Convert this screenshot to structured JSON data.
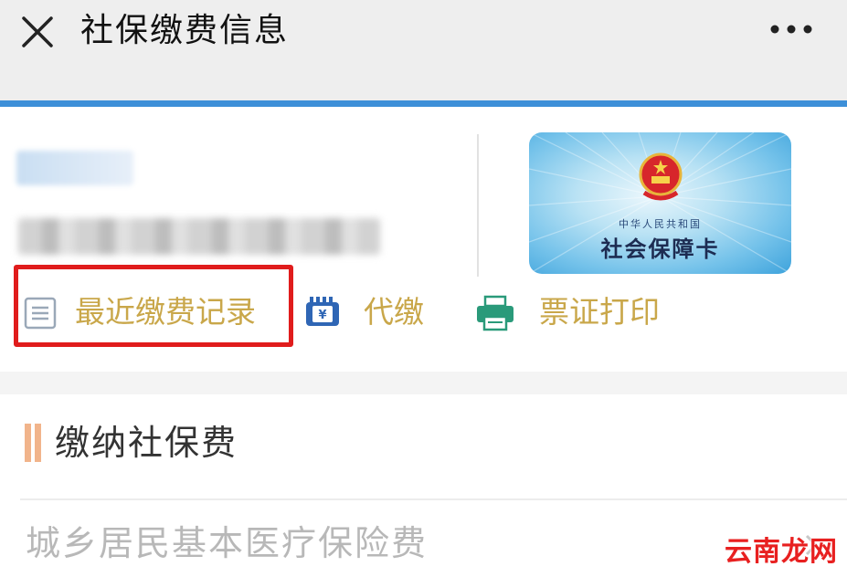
{
  "header": {
    "title": "社保缴费信息",
    "close_icon": "close-icon",
    "more_icon": "more-options-icon"
  },
  "card": {
    "country_text": "中华人民共和国",
    "card_name": "社会保障卡",
    "emblem_icon": "national-emblem-icon"
  },
  "actions": [
    {
      "label": "最近缴费记录",
      "icon": "document-list-icon",
      "highlighted": true
    },
    {
      "label": "代缴",
      "icon": "payment-card-icon",
      "highlighted": false
    },
    {
      "label": "票证打印",
      "icon": "printer-icon",
      "highlighted": false
    }
  ],
  "section": {
    "title": "缴纳社保费",
    "items": [
      {
        "label": "城乡居民基本医疗保险费"
      }
    ]
  },
  "watermark": "云南龙网",
  "colors": {
    "accent_blue": "#3d8fd8",
    "action_text": "#c9a74a",
    "highlight_red": "#e01c1c",
    "section_bar": "#f1b48b"
  }
}
